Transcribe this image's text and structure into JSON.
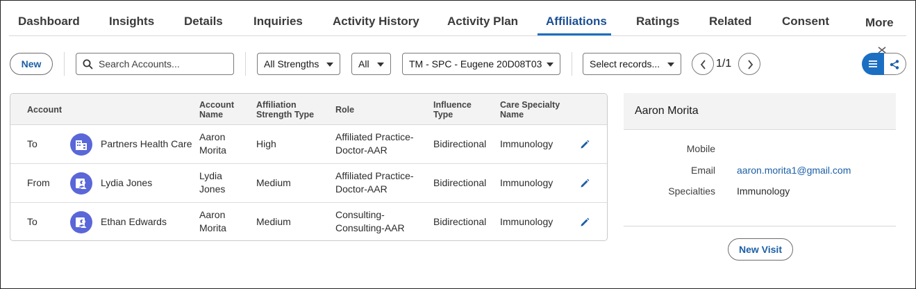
{
  "tabs": [
    {
      "label": "Dashboard",
      "active": false
    },
    {
      "label": "Insights",
      "active": false
    },
    {
      "label": "Details",
      "active": false
    },
    {
      "label": "Inquiries",
      "active": false
    },
    {
      "label": "Activity History",
      "active": false
    },
    {
      "label": "Activity Plan",
      "active": false
    },
    {
      "label": "Affiliations",
      "active": true
    },
    {
      "label": "Ratings",
      "active": false
    },
    {
      "label": "Related",
      "active": false
    },
    {
      "label": "Consent",
      "active": false
    },
    {
      "label": "More",
      "active": false
    }
  ],
  "toolbar": {
    "new_label": "New",
    "search_placeholder": "Search Accounts...",
    "strength_select": "All Strengths",
    "direction_select": "All",
    "territory_select": "TM - SPC - Eugene 20D08T03",
    "records_select": "Select records...",
    "pager": "1/1"
  },
  "table": {
    "headers": {
      "account": "Account",
      "account_name_1": "Account",
      "account_name_2": "Name",
      "strength_1": "Affiliation",
      "strength_2": "Strength Type",
      "role": "Role",
      "influence_1": "Influence",
      "influence_2": "Type",
      "specialty_1": "Care Specialty",
      "specialty_2": "Name"
    },
    "rows": [
      {
        "direction": "To",
        "account": "Partners Health Care",
        "avatar_icon": "building-icon",
        "name_1": "Aaron",
        "name_2": "Morita",
        "strength": "High",
        "role_1": "Affiliated Practice-",
        "role_2": "Doctor-AAR",
        "influence": "Bidirectional",
        "specialty": "Immunology"
      },
      {
        "direction": "From",
        "account": "Lydia Jones",
        "avatar_icon": "person-icon",
        "name_1": "Lydia",
        "name_2": "Jones",
        "strength": "Medium",
        "role_1": "Affiliated Practice-",
        "role_2": "Doctor-AAR",
        "influence": "Bidirectional",
        "specialty": "Immunology"
      },
      {
        "direction": "To",
        "account": "Ethan Edwards",
        "avatar_icon": "person-icon",
        "name_1": "Aaron",
        "name_2": "Morita",
        "strength": "Medium",
        "role_1": "Consulting-",
        "role_2": "Consulting-AAR",
        "influence": "Bidirectional",
        "specialty": "Immunology"
      }
    ]
  },
  "detail": {
    "title": "Aaron Morita",
    "mobile_label": "Mobile",
    "mobile_value": "",
    "email_label": "Email",
    "email_value": "aaron.morita1@gmail.com",
    "specialties_label": "Specialties",
    "specialties_value": "Immunology",
    "new_visit_label": "New Visit"
  },
  "colors": {
    "accent": "#1b6fc2",
    "link": "#1b5fa6",
    "avatar": "#5a67d8"
  }
}
